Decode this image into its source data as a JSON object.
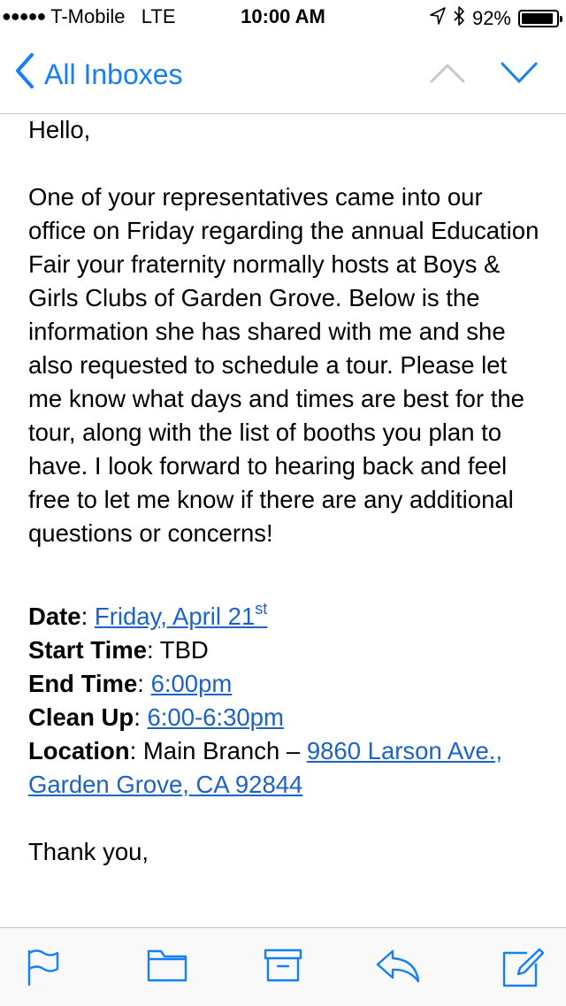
{
  "status_bar": {
    "carrier": "T-Mobile",
    "network": "LTE",
    "time": "10:00 AM",
    "battery_percent": "92%",
    "battery_level": 0.92
  },
  "nav": {
    "back_label": "All Inboxes",
    "icons": [
      "chevron-up-icon",
      "chevron-down-icon"
    ]
  },
  "email": {
    "greeting": "Hello,",
    "body": "One of your representatives came into our office on Friday regarding the annual Education Fair your fraternity normally hosts at Boys & Girls Clubs of Garden Grove. Below is the information she has shared with me and she also requested to schedule a tour. Please let me know what days and times are best for the tour, along with the list of booths you plan to have. I look forward to hearing back and feel free to let me know if there are any additional questions or concerns!",
    "details": {
      "date_label": "Date",
      "date_value": "Friday, April 21",
      "date_sup": "st",
      "start_label": "Start Time",
      "start_value": "TBD",
      "end_label": "End Time",
      "end_value": "6:00pm",
      "cleanup_label": "Clean Up",
      "cleanup_value": "6:00-6:30pm",
      "location_label": "Location",
      "location_prefix": "Main Branch – ",
      "location_address": "9860 Larson Ave., Garden Grove, CA 92844"
    },
    "closing": "Thank you,"
  },
  "toolbar": {
    "icons": [
      "flag-icon",
      "folder-icon",
      "archive-icon",
      "reply-icon",
      "compose-icon"
    ]
  },
  "colors": {
    "accent": "#157efb",
    "link": "#1d62c9",
    "disabled": "#c7c7cc"
  }
}
